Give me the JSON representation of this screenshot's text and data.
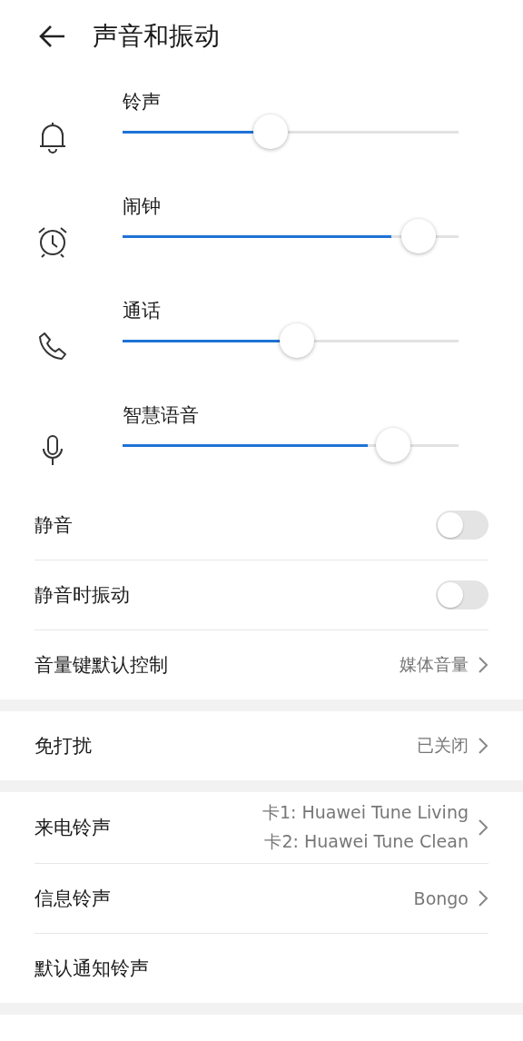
{
  "header": {
    "title": "声音和振动"
  },
  "volumes": [
    {
      "label": "铃声",
      "level": 0.4
    },
    {
      "label": "闹钟",
      "level": 0.8
    },
    {
      "label": "通话",
      "level": 0.47
    },
    {
      "label": "智慧语音",
      "level": 0.73
    }
  ],
  "sections": [
    [
      {
        "kind": "toggle",
        "label": "静音",
        "on": false
      },
      {
        "kind": "toggle",
        "label": "静音时振动",
        "on": false
      },
      {
        "kind": "link",
        "label": "音量键默认控制",
        "values": [
          "媒体音量"
        ]
      }
    ],
    [
      {
        "kind": "link",
        "label": "免打扰",
        "values": [
          "已关闭"
        ]
      }
    ],
    [
      {
        "kind": "link",
        "label": "来电铃声",
        "values": [
          "卡1: Huawei Tune Living",
          "卡2: Huawei Tune Clean"
        ]
      },
      {
        "kind": "link",
        "label": "信息铃声",
        "values": [
          "Bongo"
        ]
      },
      {
        "kind": "link",
        "label": "默认通知铃声"
      }
    ]
  ]
}
